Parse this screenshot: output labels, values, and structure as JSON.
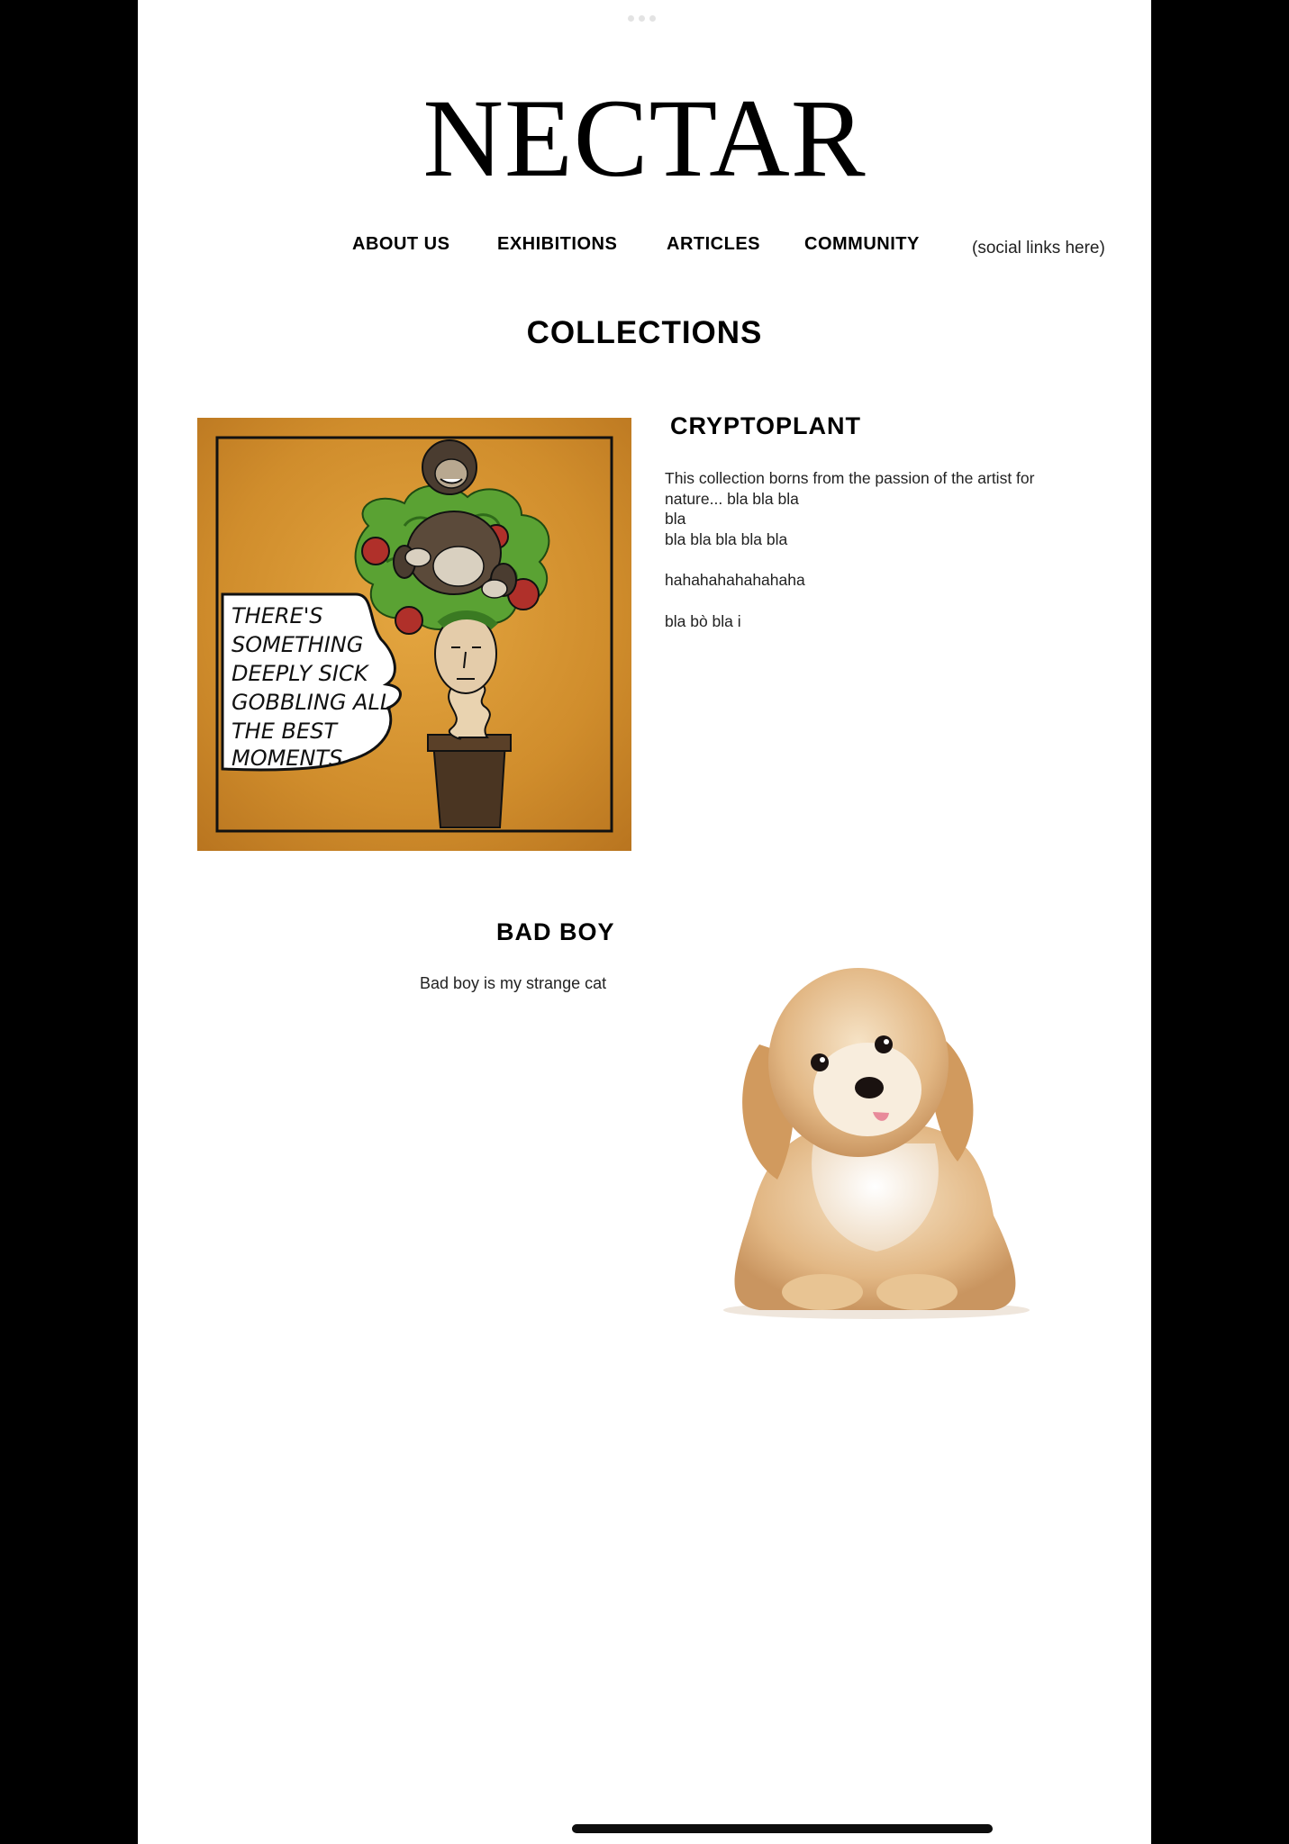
{
  "brand": {
    "logo_text": "NECTAR"
  },
  "nav": {
    "items": [
      {
        "label": "ABOUT US"
      },
      {
        "label": "EXHIBITIONS"
      },
      {
        "label": "ARTICLES"
      },
      {
        "label": "COMMUNITY"
      }
    ],
    "social": "(social links here)"
  },
  "page_title": "COLLECTIONS",
  "collections": [
    {
      "title": "CRYPTOPLANT",
      "image_caption_lines": [
        "THERE'S",
        "SOMETHING",
        "DEEPLY SICK",
        "GOBBLING ALL",
        "THE BEST",
        "MOMENTS"
      ],
      "description": [
        "This collection borns from the passion of the artist for nature... bla bla bla",
        "bla",
        "bla bla bla bla bla",
        "",
        "hahahahahahahaha",
        "",
        "bla bò bla i"
      ]
    },
    {
      "title": "BAD BOY",
      "description": "Bad boy is my strange cat",
      "image_icon": "dog-photo"
    }
  ],
  "colors": {
    "page_bg": "#ffffff",
    "outer_bg": "#000000",
    "art_bg": "#d8962c"
  }
}
